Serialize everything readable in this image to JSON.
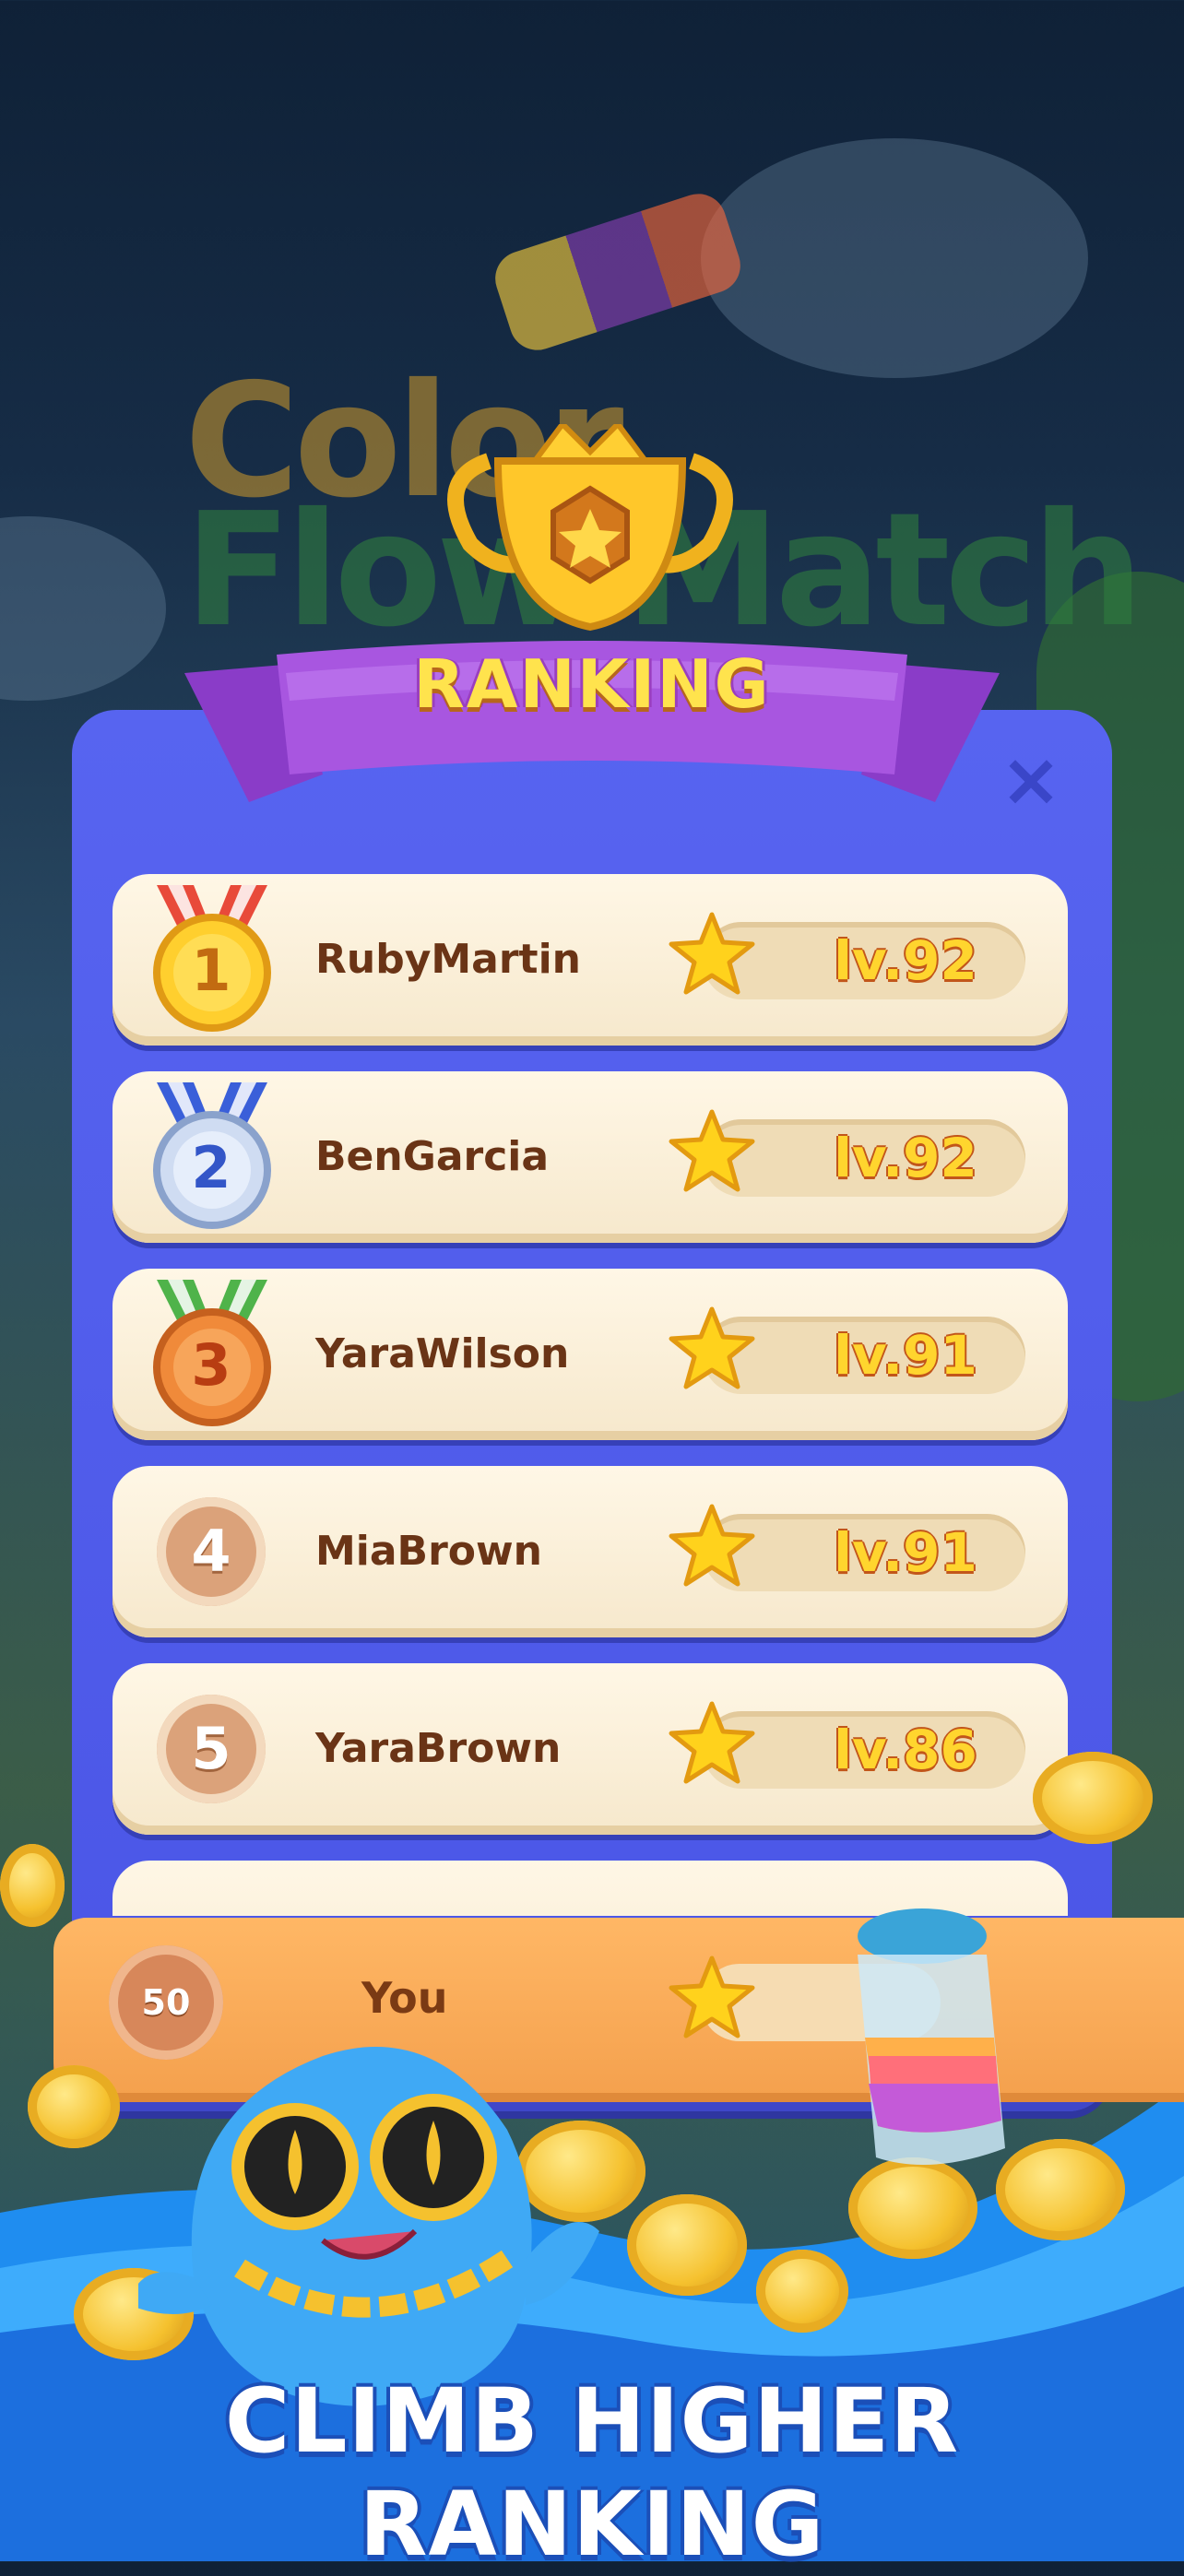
{
  "background": {
    "logo_line1": "Color",
    "logo_line2": "Flow Match"
  },
  "header": {
    "title": "RANKING"
  },
  "close_icon": "×",
  "leaderboard": [
    {
      "rank": "1",
      "name": "RubyMartin",
      "level": "lv.92",
      "medal": "gold"
    },
    {
      "rank": "2",
      "name": "BenGarcia",
      "level": "lv.92",
      "medal": "silver"
    },
    {
      "rank": "3",
      "name": "YaraWilson",
      "level": "lv.91",
      "medal": "bronze"
    },
    {
      "rank": "4",
      "name": "MiaBrown",
      "level": "lv.91",
      "medal": "none"
    },
    {
      "rank": "5",
      "name": "YaraBrown",
      "level": "lv.86",
      "medal": "none"
    }
  ],
  "current_user": {
    "rank": "50",
    "name": "You"
  },
  "promo": {
    "banner": "CLIMB HIGHER RANKING"
  },
  "colors": {
    "panel": "#4f5ae8",
    "ribbon": "#a54fdc",
    "row": "#fbf0da",
    "level_text": "#ffd52e",
    "you_bar": "#f7a955"
  }
}
